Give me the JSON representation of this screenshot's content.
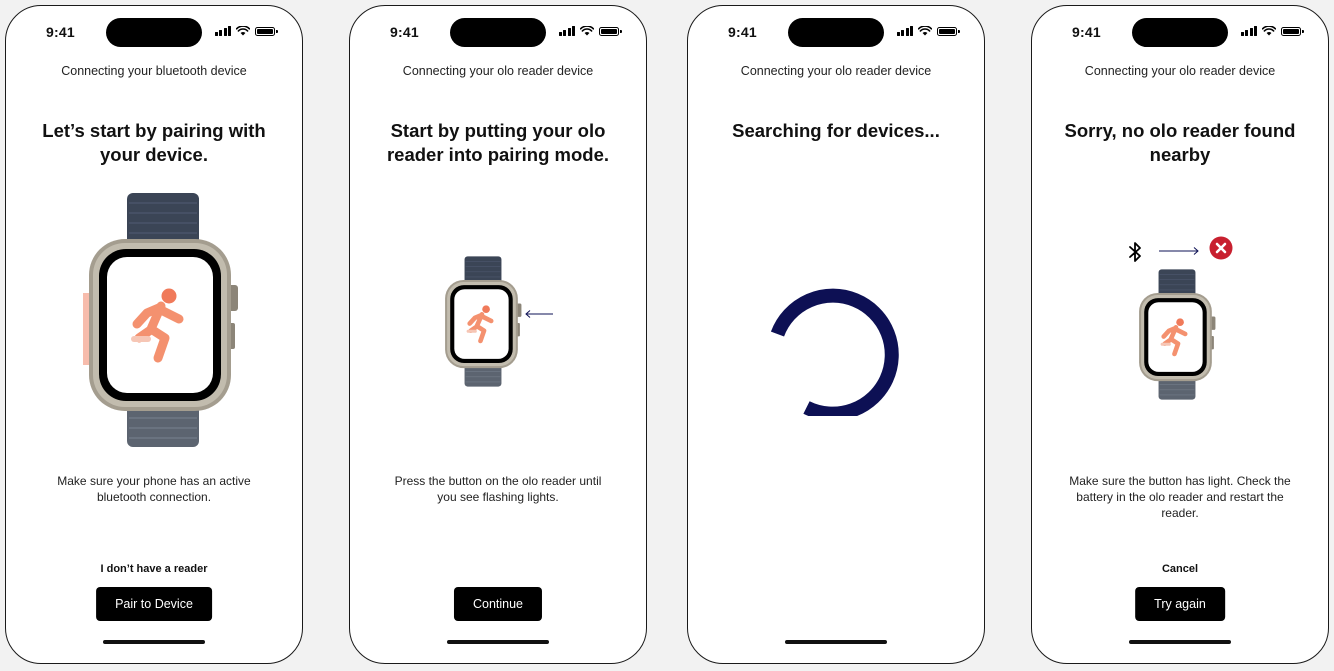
{
  "status_time": "9:41",
  "colors": {
    "accent": "#0d1054",
    "button": "#000000",
    "error": "#c8202f",
    "runner": "#f07a5a"
  },
  "screens": [
    {
      "subtitle": "Connecting your bluetooth device",
      "heading": "Let’s start by pairing with your device.",
      "description": "Make sure your phone has an active bluetooth connection.",
      "secondary_link": "I don’t have a reader",
      "primary_button": "Pair to Device"
    },
    {
      "subtitle": "Connecting your olo reader device",
      "heading": "Start by putting your olo reader into pairing mode.",
      "description": "Press the button on the olo reader until you see flashing lights.",
      "primary_button": "Continue"
    },
    {
      "subtitle": "Connecting your olo reader device",
      "heading": "Searching for devices..."
    },
    {
      "subtitle": "Connecting your olo reader device",
      "heading": "Sorry, no olo reader found nearby",
      "description": "Make sure the button has light. Check the battery in the olo reader and restart the reader.",
      "secondary_link": "Cancel",
      "primary_button": "Try again"
    }
  ],
  "icons": [
    "signal-icon",
    "wifi-icon",
    "battery-icon",
    "bluetooth-icon",
    "arrow-right-icon",
    "error-x-icon",
    "arrow-left-icon",
    "loading-spinner"
  ]
}
